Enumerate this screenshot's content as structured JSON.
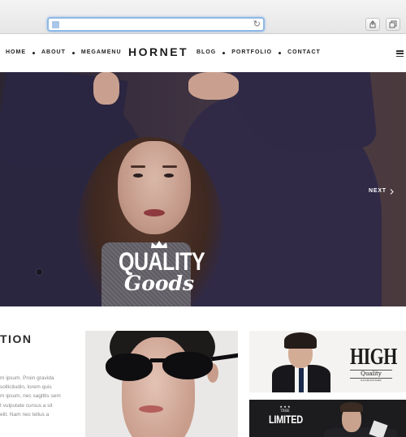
{
  "browser": {
    "reload_icon": "reload-icon",
    "share_icon": "share-icon",
    "tabs_icon": "tabs-icon"
  },
  "header": {
    "logo": "HORNET",
    "nav_left": [
      {
        "label": "HOME"
      },
      {
        "label": "ABOUT"
      },
      {
        "label": "MEGAMENU"
      }
    ],
    "nav_right": [
      {
        "label": "BLOG"
      },
      {
        "label": "PORTFOLIO"
      },
      {
        "label": "CONTACT"
      }
    ],
    "menu_icon": "hamburger-menu-icon"
  },
  "hero": {
    "headline": "QUALITY",
    "script": "Goods",
    "next_label": "NEXT",
    "next_icon": "chevron-right-icon",
    "crown_icon": "crown-icon",
    "colors": {
      "background": "#3b3040",
      "coat": "#2c2742",
      "text": "#ffffff"
    }
  },
  "content": {
    "section_title": "TION",
    "body_lines": [
      "m ipsum. Proin gravida",
      "sollicitudin, lorem quis",
      "m ipsum, nec sagittis sem",
      "t vulputate cursus a sit",
      "elit. Nam nec tellus a"
    ],
    "tiles": {
      "high": {
        "title": "HIGH",
        "subtitle": "Quality",
        "tagline": "GUARANTEED"
      },
      "limited": {
        "stars": "★ ★ ★",
        "pre": "THE",
        "title": "LIMITED"
      }
    }
  }
}
